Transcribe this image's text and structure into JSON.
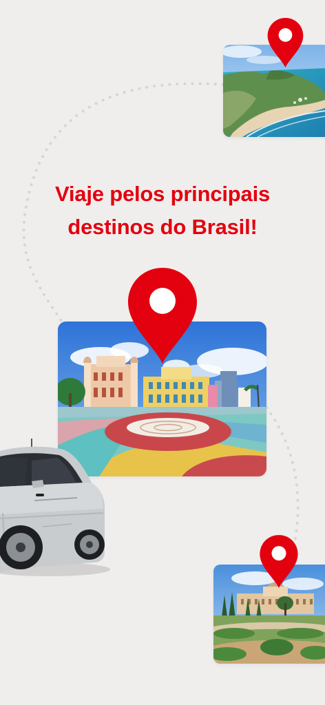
{
  "screen": {
    "headline_line1": "Viaje pelos principais",
    "headline_line2": "destinos do Brasil!"
  },
  "colors": {
    "background": "#efeeec",
    "accent": "#e3000f",
    "route_dots": "#d6d5d2"
  },
  "icons": {
    "pin_top": "map-pin-icon",
    "pin_main": "map-pin-icon",
    "pin_bottom": "map-pin-icon"
  }
}
